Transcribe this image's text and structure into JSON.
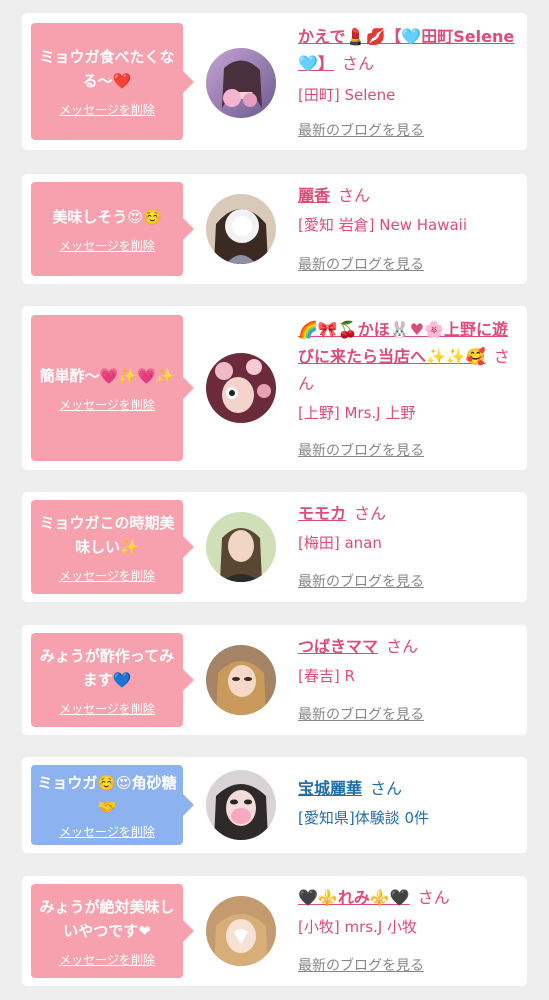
{
  "delete_label": "メッセージを削除",
  "blog_label": "最新のブログを見る",
  "san_label": "さん",
  "colors": {
    "pink_bubble": "#f7a1ae",
    "blue_bubble": "#8cb3ef",
    "name_pink": "#df4b78",
    "name_blue": "#1f6fa8"
  },
  "cards": [
    {
      "message": "ミョウガ食べたくなる〜❤️",
      "name": "かえで💄💋【🩵田町Selene🩵】",
      "shop": "[田町] Selene",
      "has_blog": true
    },
    {
      "message": "美味しそう😍☺️",
      "name": "麗香",
      "shop": "[愛知 岩倉] New Hawaii",
      "has_blog": true
    },
    {
      "message": "簡単酢〜💗✨💗✨",
      "name": "🌈🎀🍒かほ🐰♥🌸上野に遊びに来たら当店へ✨✨🥰",
      "shop": "[上野] Mrs.J 上野",
      "has_blog": true
    },
    {
      "message": "ミョウガこの時期美味しい✨",
      "name": "モモカ",
      "shop": "[梅田] anan",
      "has_blog": true
    },
    {
      "message": "みょうが酢作ってみます💙",
      "name": "つばきママ",
      "shop": "[春吉] R",
      "has_blog": true
    },
    {
      "message": "ミョウガ☺️😍角砂糖🤝",
      "name": "宝城麗華",
      "shop": "[愛知県]体験談 0件",
      "has_blog": false
    },
    {
      "message": "みょうが絶対美味しいやつです❤",
      "name": "🖤⚜️れみ⚜️🖤",
      "shop": "[小牧] mrs.J 小牧",
      "has_blog": true
    }
  ]
}
